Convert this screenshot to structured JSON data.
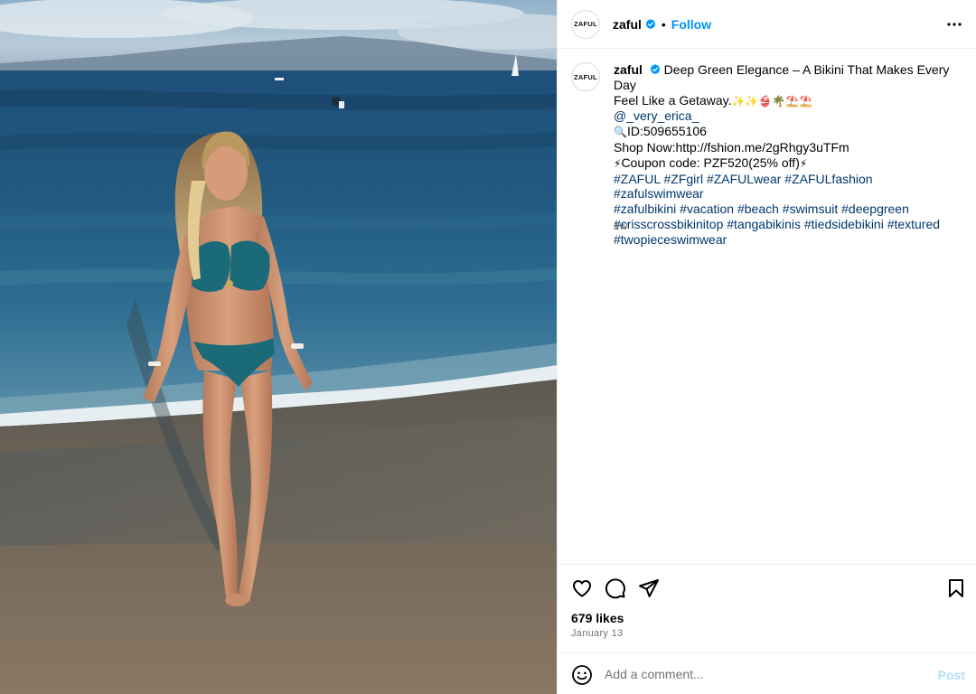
{
  "post": {
    "username": "zaful",
    "avatar_text": "ZAFUL",
    "verified": true,
    "follow_label": "Follow",
    "separator": "•"
  },
  "caption": {
    "username": "zaful",
    "title_line1": "Deep Green Elegance – A Bikini That Makes Every Day",
    "title_line2": "Feel Like a Getaway.",
    "title_emojis": "✨✨👙🌴⛱️⛱️",
    "mention": "@_very_erica_",
    "id_icon": "🔍",
    "id_text": "ID:509655106",
    "shop_text": "Shop Now:http://fshion.me/2gRhgy3uTFm",
    "coupon_icon": "⚡",
    "coupon_text": "Coupon code: PZF520(25% off)",
    "hashtags_line1": "#ZAFUL #ZFgirl #ZAFULwear #ZAFULfashion #zafulswimwear",
    "hashtags_line2": "#zafulbikini #vacation #beach #swimsuit #deepgreen",
    "hashtags_line3": "#crisscrossbikinitop #tangabikinis #tiedsidebikini #textured",
    "hashtags_line4": "#twopieceswimwear",
    "time_ago": "1w"
  },
  "stats": {
    "likes": "679 likes",
    "date": "January 13"
  },
  "comment": {
    "placeholder": "Add a comment...",
    "post_label": "Post"
  },
  "icons": {
    "header_more": "more-horizontal-icon",
    "like": "heart-icon",
    "comment": "comment-icon",
    "share": "paper-plane-icon",
    "save": "bookmark-icon",
    "emoji": "smiley-icon",
    "verified": "verified-badge-icon"
  },
  "colors": {
    "link_blue": "#00376b",
    "follow_blue": "#0095f6",
    "post_disabled": "#b2dffc",
    "muted": "#737373"
  }
}
